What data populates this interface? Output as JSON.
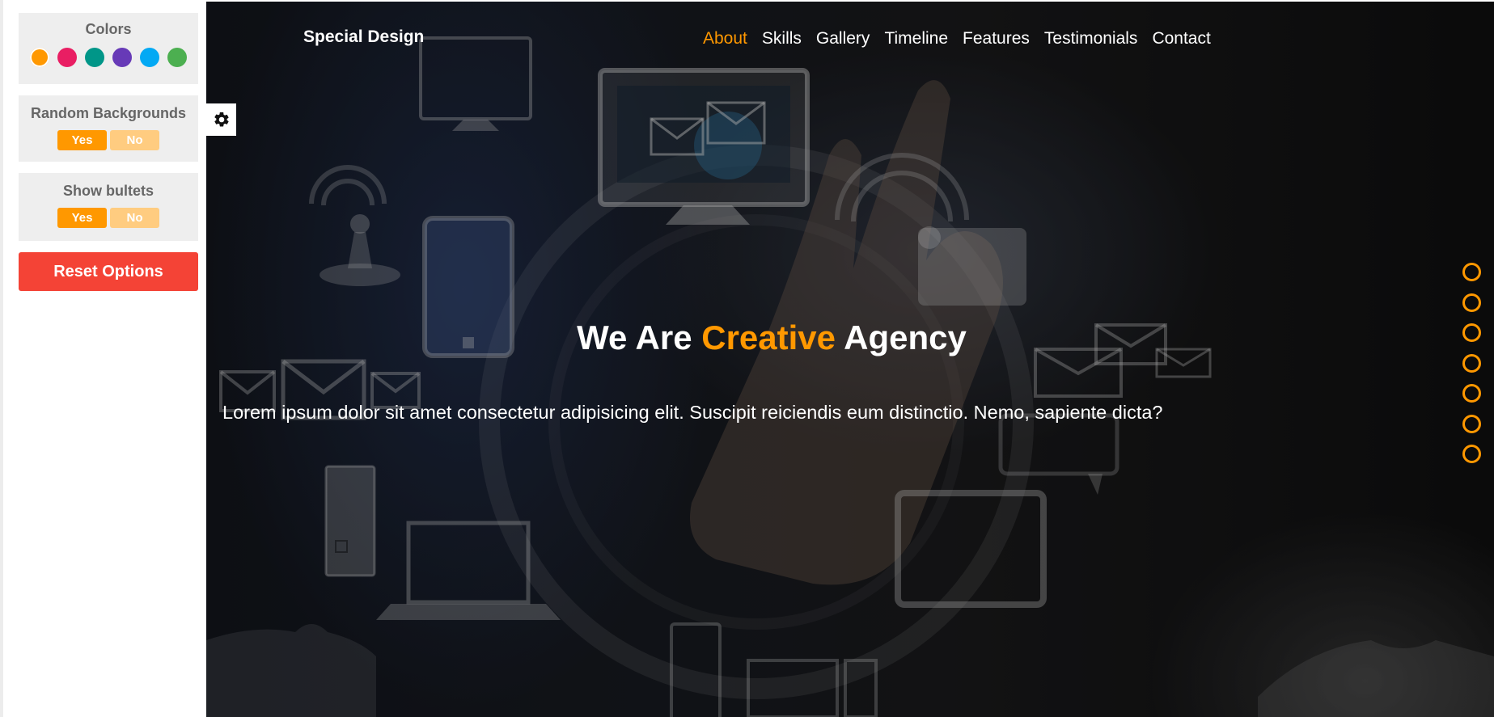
{
  "settings": {
    "colors_title": "Colors",
    "colors": [
      "#ff9800",
      "#e91e63",
      "#009688",
      "#673ab7",
      "#03a9f4",
      "#4caf50"
    ],
    "random_backgrounds_title": "Random Backgrounds",
    "show_bullets_title": "Show bultets",
    "yes_label": "Yes",
    "no_label": "No",
    "reset_label": "Reset Options",
    "gear_icon": "gear-icon"
  },
  "header": {
    "logo": "Special Design",
    "links": [
      "About",
      "Skills",
      "Gallery",
      "Timeline",
      "Features",
      "Testimonials",
      "Contact"
    ],
    "active_link": "About"
  },
  "intro": {
    "title_part1": "We Are ",
    "title_highlight": "Creative",
    "title_part2": " Agency",
    "paragraph": "Lorem ipsum dolor sit amet consectetur adipisicing elit. Suscipit reiciendis eum distinctio. Nemo, sapiente dicta?"
  },
  "bullets": {
    "count": 7
  },
  "theme": {
    "accent": "#ff9800",
    "reset": "#f44336",
    "no_button": "#ffcc80"
  }
}
